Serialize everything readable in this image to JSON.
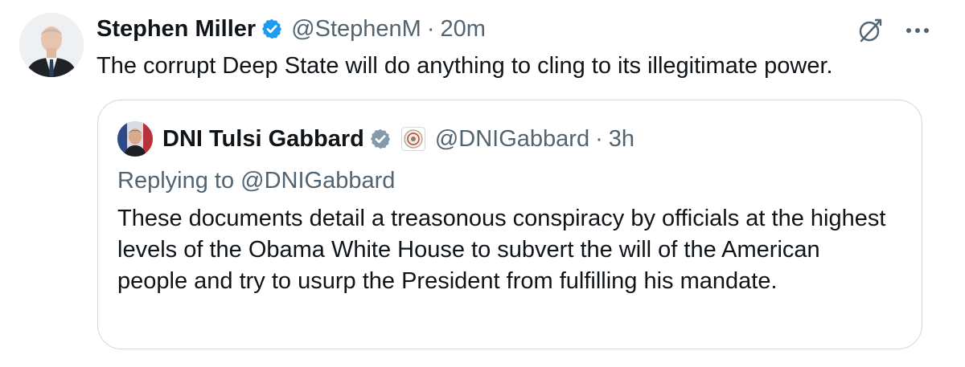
{
  "post": {
    "author_name": "Stephen Miller",
    "handle": "@StephenM",
    "separator": "·",
    "time": "20m",
    "text": "The corrupt Deep State will do anything to cling to its illegitimate power."
  },
  "quoted_post": {
    "author_name": "DNI Tulsi Gabbard",
    "handle": "@DNIGabbard",
    "separator": "·",
    "time": "3h",
    "replying_prefix": "Replying to ",
    "replying_handle": "@DNIGabbard",
    "text": "These documents detail a treasonous conspiracy by officials at the highest levels of the Obama White House to subvert the will of the American people and try to usurp the President from fulfilling his mandate."
  },
  "icons": {
    "verified_primary": "verified-badge-blue",
    "verified_quoted": "verified-badge-gray",
    "affiliate": "government-seal",
    "grok": "grok-icon",
    "more": "more-icon"
  },
  "colors": {
    "verified_blue": "#1d9bf0",
    "verified_gray": "#829aab",
    "text_primary": "#0f1419",
    "text_secondary": "#536471",
    "border": "#cfd9de"
  }
}
